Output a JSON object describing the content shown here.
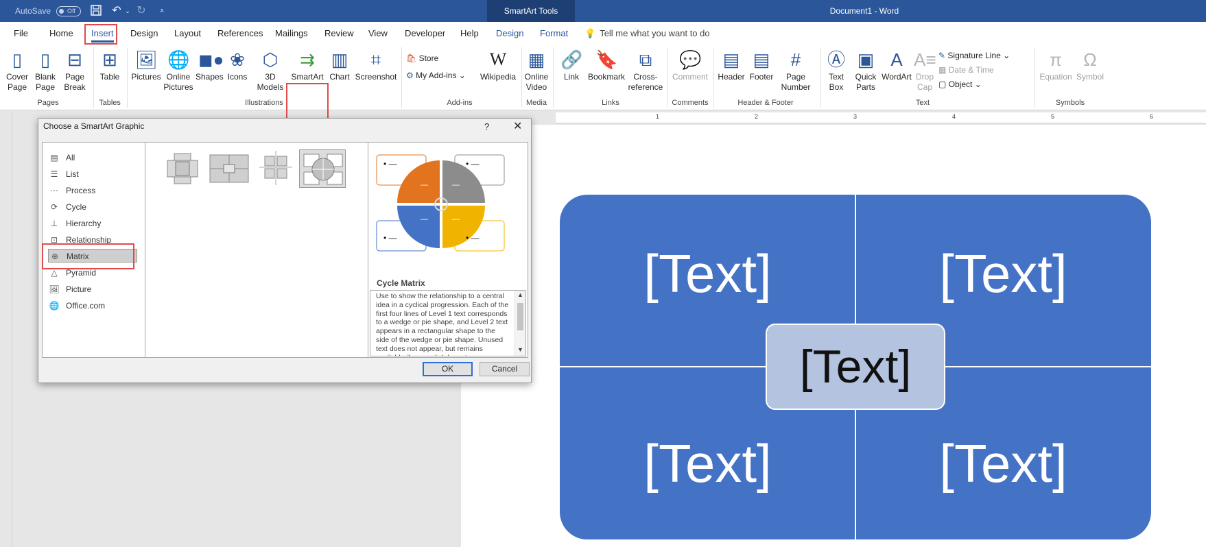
{
  "titlebar": {
    "autosave": "AutoSave",
    "toggle": "Off",
    "context": "SmartArt Tools",
    "document": "Document1  -  Word"
  },
  "tabs": [
    "File",
    "Home",
    "Insert",
    "Design",
    "Layout",
    "References",
    "Mailings",
    "Review",
    "View",
    "Developer",
    "Help",
    "Design",
    "Format"
  ],
  "tellme": "Tell me what you want to do",
  "ribbon": {
    "pages": {
      "cover": "Cover Page",
      "blank": "Blank Page",
      "break": "Page Break",
      "group": "Pages"
    },
    "tables": {
      "table": "Table",
      "group": "Tables"
    },
    "illustrations": {
      "pictures": "Pictures",
      "online": "Online Pictures",
      "shapes": "Shapes",
      "icons": "Icons",
      "models": "3D Models",
      "smartart": "SmartArt",
      "chart": "Chart",
      "screenshot": "Screenshot",
      "group": "Illustrations"
    },
    "addins": {
      "store": "Store",
      "myaddins": "My Add-ins",
      "wikipedia": "Wikipedia",
      "group": "Add-ins"
    },
    "media": {
      "video": "Online Video",
      "group": "Media"
    },
    "links": {
      "link": "Link",
      "bookmark": "Bookmark",
      "cross": "Cross-reference",
      "group": "Links"
    },
    "comments": {
      "comment": "Comment",
      "group": "Comments"
    },
    "hf": {
      "header": "Header",
      "footer": "Footer",
      "pagenum": "Page Number",
      "group": "Header & Footer"
    },
    "text": {
      "textbox": "Text Box",
      "quickparts": "Quick Parts",
      "wordart": "WordArt",
      "dropcap": "Drop Cap",
      "sigline": "Signature Line",
      "datetime": "Date & Time",
      "object": "Object",
      "group": "Text"
    },
    "symbols": {
      "equation": "Equation",
      "symbol": "Symbol",
      "group": "Symbols"
    }
  },
  "ruler": [
    "1",
    "2",
    "3",
    "4",
    "5",
    "6"
  ],
  "dialog": {
    "title": "Choose a SmartArt Graphic",
    "help": "?",
    "categories": [
      "All",
      "List",
      "Process",
      "Cycle",
      "Hierarchy",
      "Relationship",
      "Matrix",
      "Pyramid",
      "Picture",
      "Office.com"
    ],
    "preview_name": "Cycle Matrix",
    "description": "Use to show the relationship to a central idea in a cyclical progression. Each of the first four lines of Level 1 text corresponds to a wedge or pie shape, and Level 2 text appears in a rectangular shape to the side of the wedge or pie shape. Unused text does not appear, but remains available if you switch layouts.",
    "ok": "OK",
    "cancel": "Cancel",
    "bullet": "• —",
    "dash": "—"
  },
  "smartart": {
    "q1": "[Text]",
    "q2": "[Text]",
    "q3": "[Text]",
    "q4": "[Text]",
    "center": "[Text]"
  },
  "colors": {
    "accent": "#2b579a",
    "smart_blue": "#4472c4",
    "center_fill": "#b4c3e0",
    "highlight": "#e04a4a",
    "orange": "#e2731f",
    "gray": "#8c8c8c",
    "yellow": "#f0b400"
  }
}
